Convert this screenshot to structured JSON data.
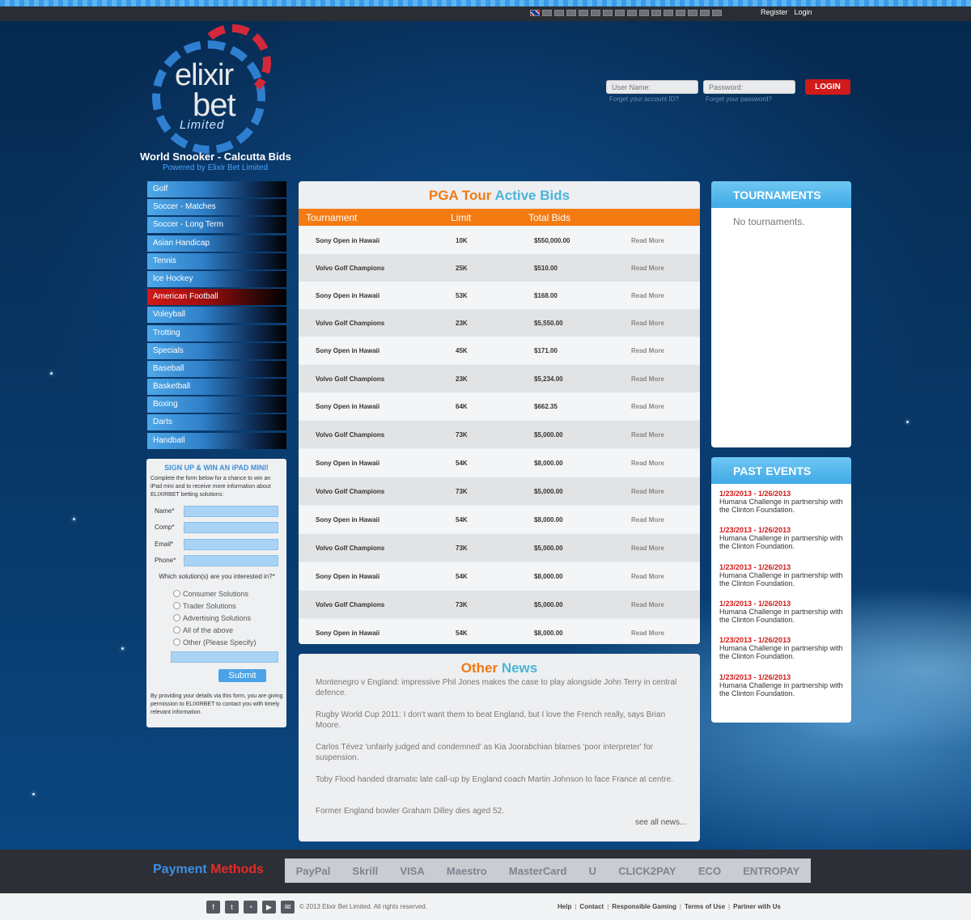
{
  "topbar": {
    "register": "Register",
    "login": "Login",
    "flags": [
      "uk-flag-icon",
      "flag-icon",
      "flag-icon",
      "flag-icon",
      "flag-icon",
      "flag-icon",
      "flag-icon",
      "flag-icon",
      "flag-icon",
      "flag-icon",
      "flag-icon",
      "flag-icon",
      "flag-icon",
      "flag-icon",
      "flag-icon",
      "flag-icon"
    ]
  },
  "brand": {
    "logo_line1": "elixir",
    "logo_line2": "bet",
    "logo_line3": "Limited",
    "title": "World Snooker - Calcutta Bids",
    "subtitle": "Powered by Elixir Bet Limited"
  },
  "login": {
    "username_placeholder": "User Name:",
    "password_placeholder": "Password:",
    "button": "LOGIN",
    "forgot_id": "Forget your account ID?",
    "forgot_password": "Forget your password?"
  },
  "sidebar": {
    "items": [
      {
        "label": "Golf"
      },
      {
        "label": "Soccer - Matches"
      },
      {
        "label": "Soccer - Long Term"
      },
      {
        "label": "Asian Handicap"
      },
      {
        "label": "Tennis"
      },
      {
        "label": "Ice Hockey"
      },
      {
        "label": "American Football",
        "active": true
      },
      {
        "label": "Voleyball"
      },
      {
        "label": "Trotting"
      },
      {
        "label": "Specials"
      },
      {
        "label": "Baseball"
      },
      {
        "label": "Basketball"
      },
      {
        "label": "Boxing"
      },
      {
        "label": "Darts"
      },
      {
        "label": "Handball"
      }
    ]
  },
  "signup": {
    "title": "SIGN UP & WIN AN iPAD MINI!",
    "intro": "Complete the form below for a chance to win an iPad mini and to receive more information about ELIXIRBET betting solutions:",
    "fields": [
      "Name*",
      "Comp*",
      "Email*",
      "Phone*"
    ],
    "question": "Which solution(s) are you interested in?*",
    "options": [
      "Consumer Solutions",
      "Trader Solutions",
      "Advertising Solutions",
      "All of the above",
      "Other (Please Specify)"
    ],
    "submit": "Submit",
    "disclaimer": "By providing your details via this form, you are giving permission to ELIXIRBET to contact you with timely relevant information."
  },
  "bids": {
    "title_part1": "PGA Tour",
    "title_part2": "Active Bids",
    "headers": [
      "Tournament",
      "Limit",
      "Total Bids"
    ],
    "read_more": "Read More",
    "rows": [
      {
        "tournament": "Sony Open in Hawaii",
        "limit": "10K",
        "total": "$550,000.00"
      },
      {
        "tournament": "Volvo Golf Champions",
        "limit": "25K",
        "total": "$510.00"
      },
      {
        "tournament": "Sony Open in Hawaii",
        "limit": "53K",
        "total": "$168.00"
      },
      {
        "tournament": "Volvo Golf Champions",
        "limit": "23K",
        "total": "$5,550.00"
      },
      {
        "tournament": "Sony Open in Hawaii",
        "limit": "45K",
        "total": "$171.00"
      },
      {
        "tournament": "Volvo Golf Champions",
        "limit": "23K",
        "total": "$5,234.00"
      },
      {
        "tournament": "Sony Open in Hawaii",
        "limit": "64K",
        "total": "$662.35"
      },
      {
        "tournament": "Volvo Golf Champions",
        "limit": "73K",
        "total": "$5,000.00"
      },
      {
        "tournament": "Sony Open in Hawaii",
        "limit": "54K",
        "total": "$8,000.00"
      },
      {
        "tournament": "Volvo Golf Champions",
        "limit": "73K",
        "total": "$5,000.00"
      },
      {
        "tournament": "Sony Open in Hawaii",
        "limit": "54K",
        "total": "$8,000.00"
      },
      {
        "tournament": "Volvo Golf Champions",
        "limit": "73K",
        "total": "$5,000.00"
      },
      {
        "tournament": "Sony Open in Hawaii",
        "limit": "54K",
        "total": "$8,000.00"
      },
      {
        "tournament": "Volvo Golf Champions",
        "limit": "73K",
        "total": "$5,000.00"
      },
      {
        "tournament": "Sony Open in Hawaii",
        "limit": "54K",
        "total": "$8,000.00"
      }
    ]
  },
  "news": {
    "title_part1": "Other",
    "title_part2": "News",
    "items": [
      "Montenegro v England: impressive Phil Jones makes the case to play alongside John Terry in central defence.",
      "Rugby World Cup 2011: I don't want them to beat England, but I love the French really, says Brian Moore.",
      "Carlos Tévez 'unfairly judged and condemned' as Kia Joorabchian blames 'poor interpreter' for suspension.",
      "Toby Flood handed dramatic late call-up by England coach Martin Johnson to face France at centre.",
      "Former England bowler Graham Dilley dies aged 52."
    ],
    "see_all": "see all news..."
  },
  "tournaments": {
    "title": "TOURNAMENTS",
    "empty": "No tournaments."
  },
  "past_events": {
    "title": "PAST EVENTS",
    "items": [
      {
        "date": "1/23/2013 - 1/26/2013",
        "text": "Humana Challenge in partnership with the Clinton Foundation."
      },
      {
        "date": "1/23/2013 - 1/26/2013",
        "text": "Humana Challenge in partnership with the Clinton Foundation."
      },
      {
        "date": "1/23/2013 - 1/26/2013",
        "text": "Humana Challenge in partnership with the Clinton Foundation."
      },
      {
        "date": "1/23/2013 - 1/26/2013",
        "text": "Humana Challenge in partnership with the Clinton Foundation."
      },
      {
        "date": "1/23/2013 - 1/26/2013",
        "text": "Humana Challenge in partnership with the Clinton Foundation."
      },
      {
        "date": "1/23/2013 - 1/26/2013",
        "text": "Humana Challenge in partnership with the Clinton Foundation."
      }
    ]
  },
  "payment": {
    "title_part1": "Payment",
    "title_part2": "Methods",
    "logos": [
      "PayPal",
      "Skrill",
      "VISA",
      "Maestro",
      "MasterCard",
      "U",
      "CLICK2PAY",
      "ECO",
      "ENTROPAY"
    ]
  },
  "footer": {
    "social": [
      "facebook-icon",
      "twitter-icon",
      "rss-icon",
      "youtube-icon",
      "email-icon"
    ],
    "copyright": "© 2013 Elixir Bet Limited.  All rights reserved.",
    "links": [
      "Help",
      "Contact",
      "Responsible Gaming",
      "Terms of Use",
      "Partner with Us"
    ]
  },
  "colors": {
    "accent_orange": "#f47a12",
    "accent_blue": "#3fa9e6",
    "accent_red": "#d11a1a",
    "background_navy": "#05254a"
  }
}
